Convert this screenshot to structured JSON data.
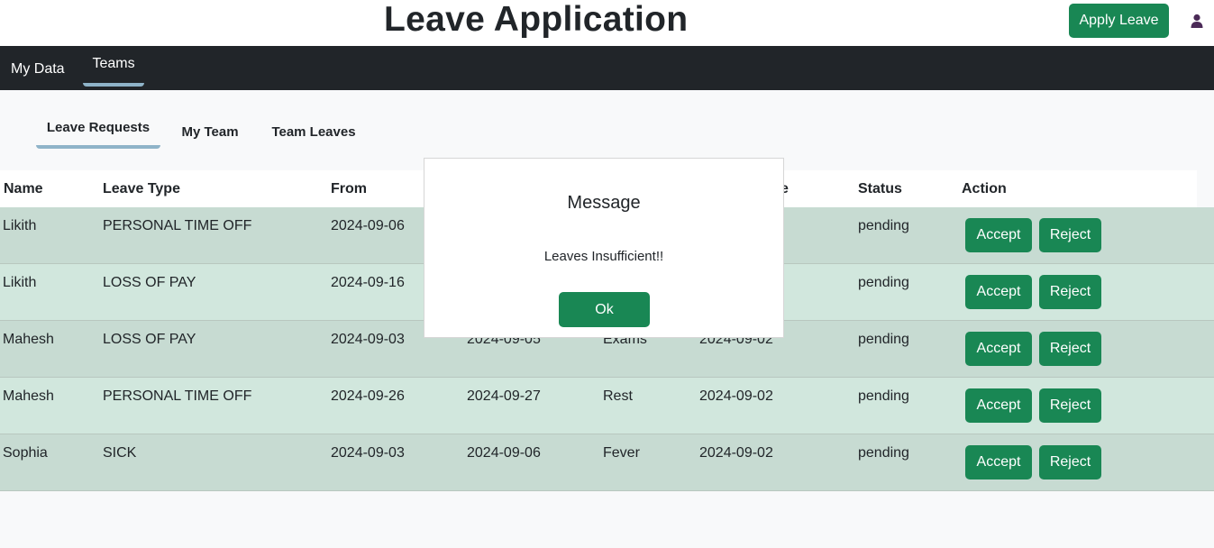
{
  "app": {
    "title": "Leave Application",
    "apply_label": "Apply Leave",
    "user_icon": "user-icon"
  },
  "navbar": {
    "items": [
      {
        "label": "My Data"
      },
      {
        "label": "Teams"
      }
    ]
  },
  "subtabs": [
    {
      "label": "Leave Requests"
    },
    {
      "label": "My Team"
    },
    {
      "label": "Team Leaves"
    }
  ],
  "table": {
    "headers": [
      "Name",
      "Leave Type",
      "From",
      "",
      "",
      "",
      "Status",
      "Action"
    ],
    "partial_header_suffix": "e",
    "rows": [
      {
        "name": "Likith",
        "type": "PERSONAL TIME OFF",
        "from": "2024-09-06",
        "to": "",
        "reason": "",
        "applied": "",
        "status": "pending"
      },
      {
        "name": "Likith",
        "type": "LOSS OF PAY",
        "from": "2024-09-16",
        "to": "",
        "reason": "",
        "applied": "",
        "status": "pending"
      },
      {
        "name": "Mahesh",
        "type": "LOSS OF PAY",
        "from": "2024-09-03",
        "to": "2024-09-05",
        "reason": "Exams",
        "applied": "2024-09-02",
        "status": "pending"
      },
      {
        "name": "Mahesh",
        "type": "PERSONAL TIME OFF",
        "from": "2024-09-26",
        "to": "2024-09-27",
        "reason": "Rest",
        "applied": "2024-09-02",
        "status": "pending"
      },
      {
        "name": "Sophia",
        "type": "SICK",
        "from": "2024-09-03",
        "to": "2024-09-06",
        "reason": "Fever",
        "applied": "2024-09-02",
        "status": "pending"
      }
    ],
    "accept_label": "Accept",
    "reject_label": "Reject"
  },
  "modal": {
    "title": "Message",
    "body": "Leaves Insufficient!!",
    "ok_label": "Ok"
  },
  "colors": {
    "accent": "#198754",
    "navbar": "#212529",
    "tab_underline": "#8fb4c9",
    "row_odd": "#c7dbd2",
    "row_even": "#d1e7dd"
  }
}
